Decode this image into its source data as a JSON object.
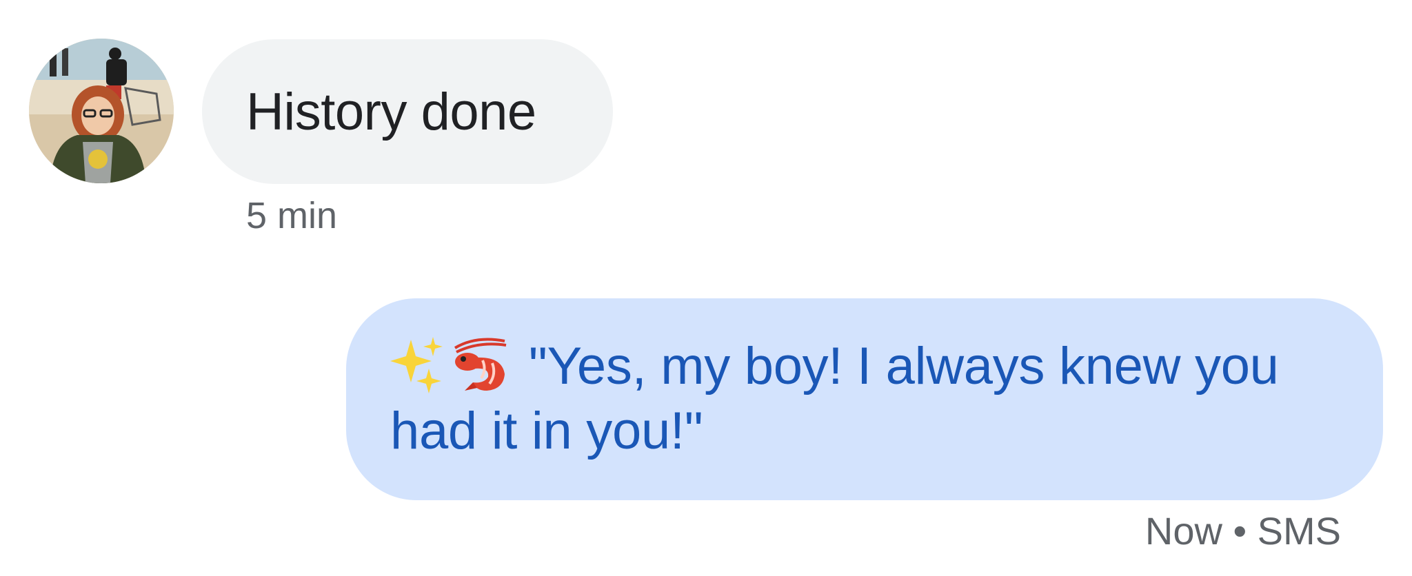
{
  "conversation": {
    "incoming": {
      "avatar_icon": "contact-photo-avatar",
      "text": "History done",
      "time": "5 min"
    },
    "outgoing": {
      "emoji_icons": [
        "sparkles-icon",
        "shrimp-icon"
      ],
      "text": "\"Yes, my boy! I always knew you had it in you!\"",
      "time": "Now",
      "separator": "•",
      "channel": "SMS"
    }
  },
  "colors": {
    "incoming_bubble": "#f1f3f4",
    "outgoing_bubble": "#d3e3fd",
    "outgoing_text": "#1a57b6",
    "incoming_text": "#202124",
    "meta_text": "#5f6368"
  }
}
